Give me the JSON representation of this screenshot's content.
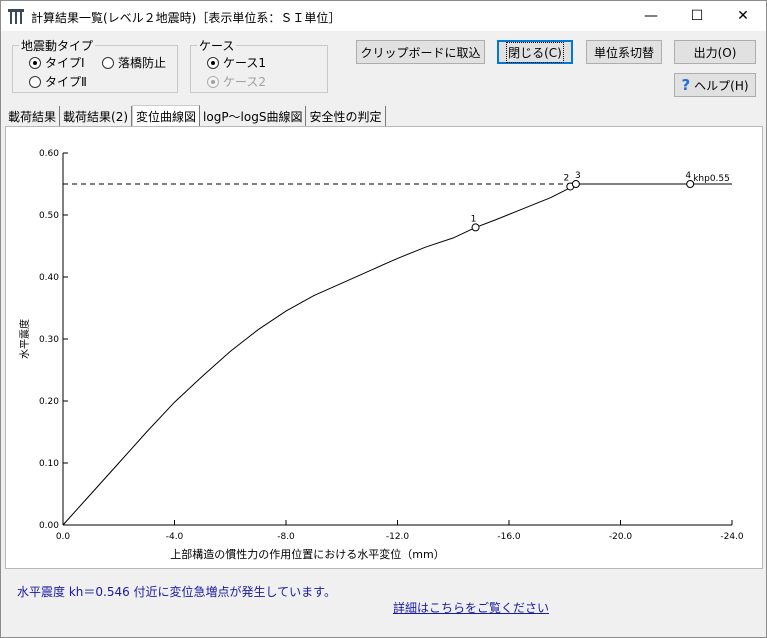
{
  "window": {
    "title": "計算結果一覧(レベル２地震時)［表示単位系：ＳＩ単位］",
    "controls": {
      "minimize": "—",
      "maximize": "☐",
      "close": "✕"
    }
  },
  "groups": {
    "motion_type": {
      "title": "地震動タイプ",
      "options": [
        {
          "label": "タイプⅠ",
          "checked": true,
          "enabled": true
        },
        {
          "label": "落橋防止",
          "checked": false,
          "enabled": true
        },
        {
          "label": "タイプⅡ",
          "checked": false,
          "enabled": true
        }
      ]
    },
    "case": {
      "title": "ケース",
      "options": [
        {
          "label": "ケース1",
          "checked": true,
          "enabled": true
        },
        {
          "label": "ケース2",
          "checked": true,
          "enabled": false
        }
      ]
    }
  },
  "buttons": {
    "clipboard": "クリップボードに取込",
    "close": "閉じる(C)",
    "unit_switch": "単位系切替",
    "output": "出力(O)",
    "help": "ヘルプ(H)"
  },
  "tabs": [
    {
      "label": "載荷結果",
      "active": false
    },
    {
      "label": "載荷結果(2)",
      "active": false
    },
    {
      "label": "変位曲線図",
      "active": true
    },
    {
      "label": "logP～logS曲線図",
      "active": false
    },
    {
      "label": "安全性の判定",
      "active": false
    }
  ],
  "chart_data": {
    "type": "line",
    "title": "",
    "xlabel": "上部構造の慣性力の作用位置における水平変位（mm）",
    "ylabel": "水平震度",
    "xlim": [
      0.0,
      -24.0
    ],
    "ylim": [
      0.0,
      0.6
    ],
    "x_ticks": [
      "0.0",
      "-4.0",
      "-8.0",
      "-12.0",
      "-16.0",
      "-20.0",
      "-24.0"
    ],
    "y_ticks": [
      "0.00",
      "0.10",
      "0.20",
      "0.30",
      "0.40",
      "0.50",
      "0.60"
    ],
    "grid": false,
    "curve": {
      "x": [
        0.0,
        -1.0,
        -2.0,
        -3.0,
        -4.0,
        -5.0,
        -6.0,
        -7.0,
        -8.0,
        -9.0,
        -10.0,
        -11.0,
        -12.0,
        -13.0,
        -14.0,
        -14.8,
        -15.5,
        -16.5,
        -17.5,
        -18.2,
        -18.4,
        -22.5,
        -24.0
      ],
      "y": [
        0.0,
        0.05,
        0.1,
        0.15,
        0.198,
        0.24,
        0.28,
        0.315,
        0.345,
        0.37,
        0.39,
        0.41,
        0.43,
        0.448,
        0.463,
        0.48,
        0.492,
        0.51,
        0.528,
        0.544,
        0.55,
        0.55,
        0.55
      ]
    },
    "points": [
      {
        "label": "1",
        "x": -14.8,
        "y": 0.48
      },
      {
        "label": "2",
        "x": -18.2,
        "y": 0.546
      },
      {
        "label": "3",
        "x": -18.4,
        "y": 0.55
      },
      {
        "label": "4",
        "x": -22.5,
        "y": 0.55
      }
    ],
    "khp_line": {
      "value": 0.55,
      "label": "khp0.55",
      "style": "dashed"
    }
  },
  "status": {
    "message": "水平震度 kh＝0.546 付近に変位急増点が発生しています。",
    "link": "詳細はこちらをご覧ください"
  }
}
